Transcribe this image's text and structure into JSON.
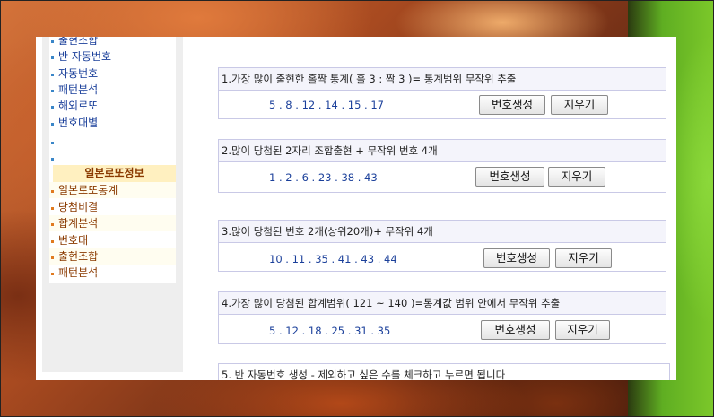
{
  "sidebar": {
    "items": [
      {
        "label": "출현조합"
      },
      {
        "label": "반 자동번호"
      },
      {
        "label": "자동번호"
      },
      {
        "label": "패턴분석"
      },
      {
        "label": "해외로또"
      },
      {
        "label": "번호대별"
      }
    ],
    "japan_header": "일본로또정보",
    "japan_items": [
      {
        "label": "일본로또통계"
      },
      {
        "label": "당첨비결"
      },
      {
        "label": "합계분석"
      },
      {
        "label": "번호대"
      },
      {
        "label": "출현조합"
      },
      {
        "label": "패턴분석"
      }
    ]
  },
  "sections": [
    {
      "title": "1.가장 많이 출현한 홀짝 통계( 홀 3 : 짝 3 )= 통계범위 무작위 추출",
      "numbers": "5 . 8 . 12 . 14 . 15 . 17",
      "generate_label": "번호생성",
      "clear_label": "지우기"
    },
    {
      "title": "2.많이 당첨된 2자리 조합출현 + 무작위 번호 4개",
      "numbers": "1 . 2 . 6 . 23 . 38 . 43",
      "generate_label": "번호생성",
      "clear_label": "지우기"
    },
    {
      "title": "3.많이 당첨된 번호 2개(상위20개)+ 무작위 4개",
      "numbers": "10 . 11 . 35 . 41 . 43 . 44",
      "generate_label": "번호생성",
      "clear_label": "지우기"
    },
    {
      "title": "4.가장 많이 당첨된 합계범위( 121 ~ 140 )=통계값 범위 안에서 무작위 추출",
      "numbers": "5 . 12 . 18 . 25 . 31 . 35",
      "generate_label": "번호생성",
      "clear_label": "지우기"
    },
    {
      "title": "5. 반 자동번호 생성 - 제외하고 싶은 수를 체크하고 누르면 됩니다"
    }
  ]
}
